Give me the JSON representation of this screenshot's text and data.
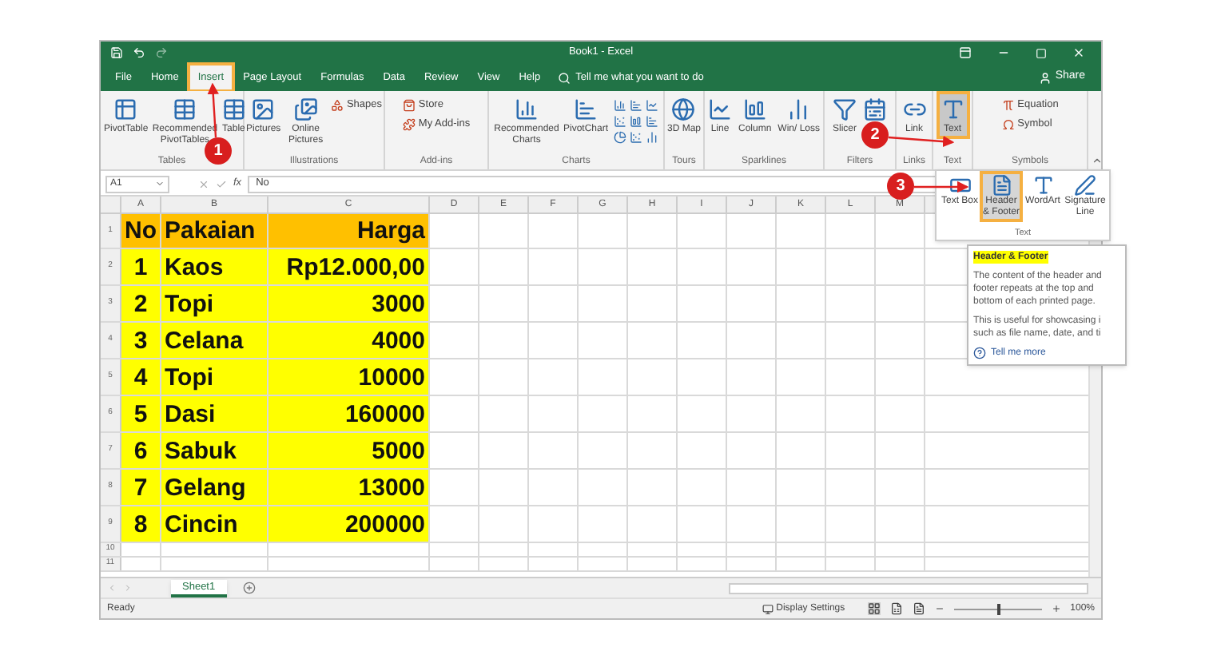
{
  "window": {
    "title": "Book1 - Excel"
  },
  "ribbon_tabs": [
    {
      "label": "File",
      "selected": false,
      "highlighted": false
    },
    {
      "label": "Home",
      "selected": false,
      "highlighted": false
    },
    {
      "label": "Insert",
      "selected": true,
      "highlighted": true
    },
    {
      "label": "Page Layout",
      "selected": false,
      "highlighted": false
    },
    {
      "label": "Formulas",
      "selected": false,
      "highlighted": false
    },
    {
      "label": "Data",
      "selected": false,
      "highlighted": false
    },
    {
      "label": "Review",
      "selected": false,
      "highlighted": false
    },
    {
      "label": "View",
      "selected": false,
      "highlighted": false
    },
    {
      "label": "Help",
      "selected": false,
      "highlighted": false
    }
  ],
  "tell_me": {
    "placeholder": "Tell me what you want to do"
  },
  "share": "Share",
  "ribbon_groups": [
    {
      "label": "Tables",
      "buttons": [
        {
          "kind": "large",
          "label": "PivotTable",
          "highlighted": false
        },
        {
          "kind": "large",
          "label": "Recommended PivotTables",
          "highlighted": false
        },
        {
          "kind": "large",
          "label": "Table",
          "highlighted": false
        }
      ]
    },
    {
      "label": "Illustrations",
      "buttons": [
        {
          "kind": "large",
          "label": "Pictures",
          "highlighted": false
        },
        {
          "kind": "large",
          "label": "Online Pictures",
          "highlighted": false
        },
        {
          "kind": "small",
          "label": "Shapes",
          "highlighted": false
        }
      ]
    },
    {
      "label": "Add-ins",
      "buttons": [
        {
          "kind": "small",
          "label": "Store",
          "highlighted": false
        },
        {
          "kind": "small",
          "label": "My Add-ins",
          "highlighted": false
        }
      ]
    },
    {
      "label": "Charts",
      "buttons": [
        {
          "kind": "large",
          "label": "Recommended Charts",
          "highlighted": false
        },
        {
          "kind": "large",
          "label": "PivotChart",
          "highlighted": false
        }
      ]
    },
    {
      "label": "Tours",
      "buttons": [
        {
          "kind": "large",
          "label": "3D Map",
          "highlighted": false
        }
      ]
    },
    {
      "label": "Sparklines",
      "buttons": [
        {
          "kind": "large",
          "label": "Line",
          "highlighted": false
        },
        {
          "kind": "large",
          "label": "Column",
          "highlighted": false
        },
        {
          "kind": "large",
          "label": "Win/ Loss",
          "highlighted": false
        }
      ]
    },
    {
      "label": "Filters",
      "buttons": [
        {
          "kind": "large",
          "label": "Slicer",
          "highlighted": false
        },
        {
          "kind": "large",
          "highlighted": false
        }
      ]
    },
    {
      "label": "Links",
      "buttons": [
        {
          "kind": "large",
          "label": "Link",
          "highlighted": false
        }
      ]
    },
    {
      "label": "Text",
      "buttons": [
        {
          "kind": "large",
          "label": "Text",
          "highlighted": true
        }
      ]
    },
    {
      "label": "Symbols",
      "buttons": [
        {
          "kind": "small",
          "label": "Equation",
          "highlighted": false
        },
        {
          "kind": "small",
          "label": "Symbol",
          "highlighted": false
        }
      ]
    }
  ],
  "formula_bar": {
    "name_box": "A1",
    "function_label": "fx",
    "value": "No"
  },
  "columns": [
    "A",
    "B",
    "C",
    "D",
    "E",
    "F",
    "G",
    "H",
    "I",
    "J",
    "K",
    "L",
    "M"
  ],
  "rows": [
    {
      "header": "1",
      "kind": "heading",
      "cells": [
        "No",
        "Pakaian",
        "Harga"
      ]
    },
    {
      "header": "2",
      "kind": "data",
      "cells": [
        "1",
        "Kaos",
        "Rp12.000,00"
      ]
    },
    {
      "header": "3",
      "kind": "data",
      "cells": [
        "2",
        "Topi",
        "3000"
      ]
    },
    {
      "header": "4",
      "kind": "data",
      "cells": [
        "3",
        "Celana",
        "4000"
      ]
    },
    {
      "header": "5",
      "kind": "data",
      "cells": [
        "4",
        "Topi",
        "10000"
      ]
    },
    {
      "header": "6",
      "kind": "data",
      "cells": [
        "5",
        "Dasi",
        "160000"
      ]
    },
    {
      "header": "7",
      "kind": "data",
      "cells": [
        "6",
        "Sabuk",
        "5000"
      ]
    },
    {
      "header": "8",
      "kind": "data",
      "cells": [
        "7",
        "Gelang",
        "13000"
      ]
    },
    {
      "header": "9",
      "kind": "data",
      "cells": [
        "8",
        "Cincin",
        "200000"
      ]
    },
    {
      "header": "10",
      "kind": "empty",
      "cells": []
    },
    {
      "header": "11",
      "kind": "empty",
      "cells": []
    }
  ],
  "text_gallery": {
    "group": "Text",
    "items": [
      {
        "label": "Text Box",
        "selected": false
      },
      {
        "label": "Header & Footer",
        "selected": true
      },
      {
        "label": "WordArt",
        "selected": false
      },
      {
        "label": "Signature Line",
        "selected": false
      }
    ]
  },
  "tooltip": {
    "title": "Header & Footer",
    "paragraphs": [
      "The content of the header and footer repeats at the top and bottom of each printed page.",
      "This is useful for showcasing i such as file name, date, and ti"
    ],
    "link": "Tell me more"
  },
  "annotations": [
    {
      "label": "1"
    },
    {
      "label": "2"
    },
    {
      "label": "3"
    }
  ],
  "sheet_tabs": [
    {
      "label": "Sheet1",
      "selected": true
    }
  ],
  "status_bar": {
    "text": "Ready",
    "display_settings": "Display Settings",
    "zoom": "100%",
    "level": 0.5
  }
}
